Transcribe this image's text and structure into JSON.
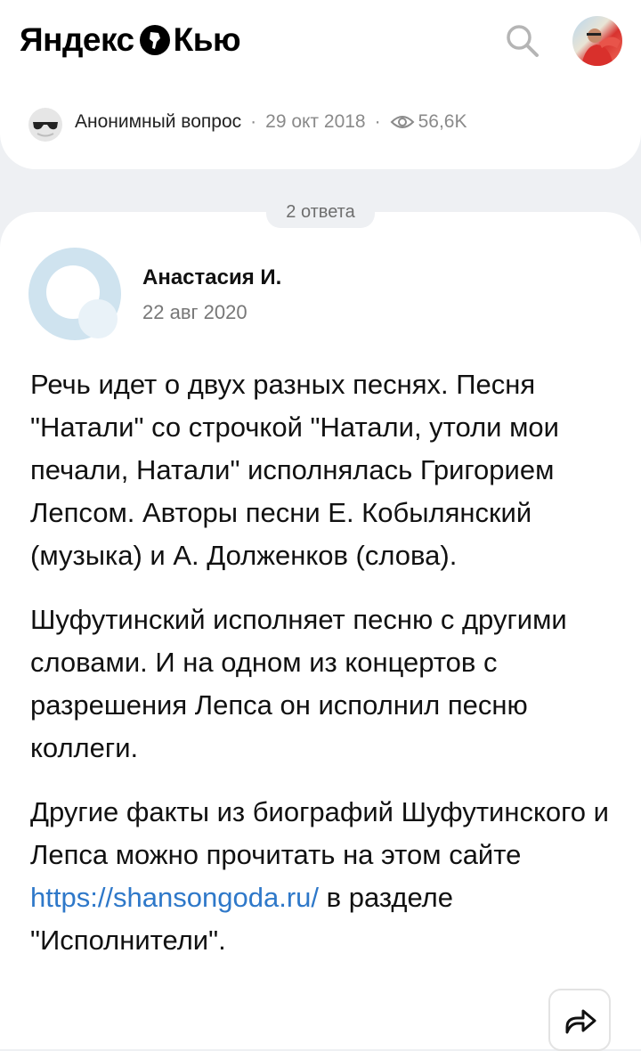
{
  "header": {
    "logo_left": "Яндекс",
    "logo_right": "Кью"
  },
  "question": {
    "author": "Анонимный вопрос",
    "date": "29 окт 2018",
    "views": "56,6K"
  },
  "answers_count": "2 ответа",
  "answer": {
    "author_name": "Анастасия И.",
    "date": "22 авг 2020",
    "paragraph1": "Речь идет о двух разных песнях. Песня \"Натали\" со строчкой \"Натали, утоли мои печали, Натали\" исполнялась Григорием Лепсом. Авторы песни Е. Кобылянский (музыка) и А. Долженков (слова).",
    "paragraph2": "Шуфутинский исполняет песню с другими словами. И на одном из концертов с разрешения Лепса он исполнил песню коллеги.",
    "paragraph3_before": "Другие факты из биографий Шуфутинского и Лепса можно прочитать на этом сайте ",
    "paragraph3_link": "https://shansongoda.ru/",
    "paragraph3_after": " в разделе \"Исполнители\"."
  },
  "colors": {
    "background": "#eef0f3",
    "link": "#2e78c9",
    "muted_text": "#777777"
  },
  "icons": {
    "search": "search-icon",
    "eye": "eye-icon",
    "anonymous": "anonymous-avatar-icon",
    "share": "share-icon",
    "logo_mark": "yandex-q-logo-icon"
  }
}
